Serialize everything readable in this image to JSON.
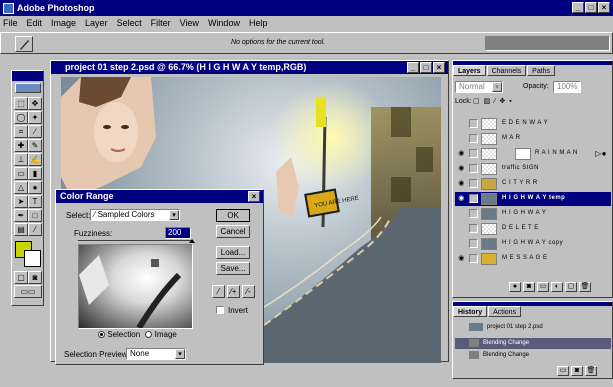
{
  "app": {
    "title": "Adobe Photoshop"
  },
  "menubar": {
    "items": [
      "File",
      "Edit",
      "Image",
      "Layer",
      "Select",
      "Filter",
      "View",
      "Window",
      "Help"
    ]
  },
  "options_bar": {
    "hint": "No options for the current tool."
  },
  "document": {
    "title": "project 01 step 2.psd @ 66.7% (H I G H W A Y temp,RGB)"
  },
  "color_range": {
    "title": "Color Range",
    "select_label": "Select:",
    "select_value": "Sampled Colors",
    "fuzziness_label": "Fuzziness:",
    "fuzziness_value": "200",
    "buttons": {
      "ok": "OK",
      "cancel": "Cancel",
      "load": "Load...",
      "save": "Save..."
    },
    "invert_label": "Invert",
    "radio_selection": "Selection",
    "radio_image": "Image",
    "preview_label": "Selection Preview:",
    "preview_value": "None"
  },
  "layers_panel": {
    "tabs": [
      "Layers",
      "Channels",
      "Paths"
    ],
    "opacity_label": "Opacity:",
    "lock_label": "Lock:",
    "layers": [
      {
        "name": "E D E N  W A Y",
        "visible": false,
        "selected": false
      },
      {
        "name": "M A R",
        "visible": false,
        "selected": false
      },
      {
        "name": "R A I N  M A N",
        "visible": true,
        "selected": false
      },
      {
        "name": "traffic SIGN",
        "visible": true,
        "selected": false
      },
      {
        "name": "C I T Y  R R",
        "visible": true,
        "selected": false
      },
      {
        "name": "H I G H W A Y  temp",
        "visible": true,
        "selected": true
      },
      {
        "name": "H I G H W A Y",
        "visible": false,
        "selected": false
      },
      {
        "name": "D E L E T E",
        "visible": false,
        "selected": false
      },
      {
        "name": "H I G H W A Y copy",
        "visible": false,
        "selected": false
      },
      {
        "name": "M E S S A G E",
        "visible": true,
        "selected": false
      }
    ]
  },
  "history_panel": {
    "tabs": [
      "History",
      "Actions"
    ],
    "items": [
      {
        "name": "project 01 step 2.psd",
        "selected": false
      },
      {
        "name": "Blending Change",
        "selected": true
      },
      {
        "name": "Blending Change",
        "selected": false
      }
    ]
  },
  "sign_text": "YOU ARE HERE",
  "colors": {
    "titlebar": "#000080",
    "foreground_swatch": "#c8d400",
    "background_swatch": "#ffffff"
  }
}
